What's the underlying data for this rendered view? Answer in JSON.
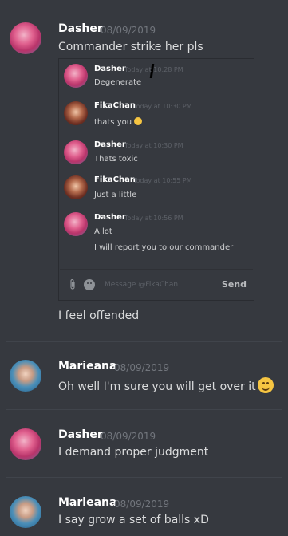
{
  "messages": [
    {
      "username": "Dasher",
      "timestamp": "08/09/2019",
      "text": "Commander strike her pls",
      "followup": "I feel offended"
    },
    {
      "username": "Marieana",
      "timestamp": "08/09/2019",
      "text": "Oh well I'm sure you will get over it"
    },
    {
      "username": "Dasher",
      "timestamp": "08/09/2019",
      "text": "I demand proper judgment"
    },
    {
      "username": "Marieana",
      "timestamp": "08/09/2019",
      "text": "I say grow a set of balls xD"
    }
  ],
  "embed": {
    "messages": [
      {
        "username": "Dasher",
        "timestamp": "Today at 10:28 PM",
        "lines": [
          "Degenerate"
        ]
      },
      {
        "username": "FikaChan",
        "timestamp": "Today at 10:30 PM",
        "lines": [
          "thats you"
        ]
      },
      {
        "username": "Dasher",
        "timestamp": "Today at 10:30 PM",
        "lines": [
          "Thats toxic"
        ]
      },
      {
        "username": "FikaChan",
        "timestamp": "Today at 10:55 PM",
        "lines": [
          "Just a little"
        ]
      },
      {
        "username": "Dasher",
        "timestamp": "Today at 10:56 PM",
        "lines": [
          "A lot",
          "I will report you to our commander"
        ]
      }
    ],
    "input_placeholder": "Message @FikaChan",
    "send_label": "Send"
  }
}
